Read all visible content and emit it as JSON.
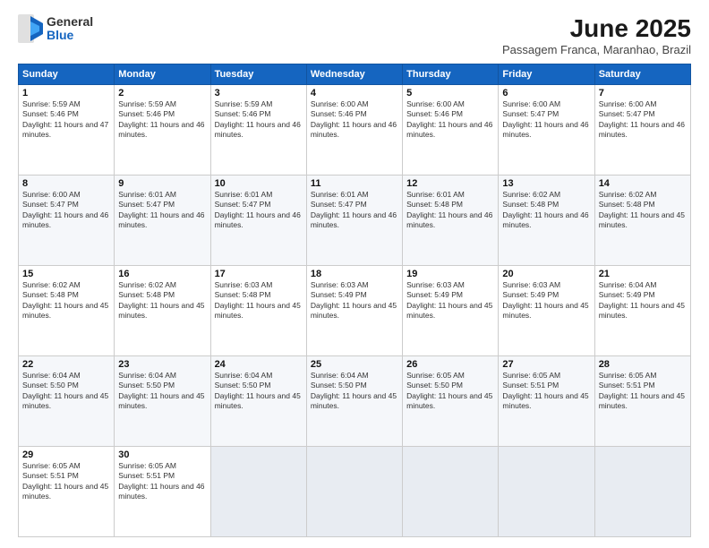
{
  "logo": {
    "general": "General",
    "blue": "Blue"
  },
  "title": "June 2025",
  "subtitle": "Passagem Franca, Maranhao, Brazil",
  "days_of_week": [
    "Sunday",
    "Monday",
    "Tuesday",
    "Wednesday",
    "Thursday",
    "Friday",
    "Saturday"
  ],
  "weeks": [
    [
      {
        "day": 1,
        "sunrise": "5:59 AM",
        "sunset": "5:46 PM",
        "daylight": "11 hours and 47 minutes."
      },
      {
        "day": 2,
        "sunrise": "5:59 AM",
        "sunset": "5:46 PM",
        "daylight": "11 hours and 46 minutes."
      },
      {
        "day": 3,
        "sunrise": "5:59 AM",
        "sunset": "5:46 PM",
        "daylight": "11 hours and 46 minutes."
      },
      {
        "day": 4,
        "sunrise": "6:00 AM",
        "sunset": "5:46 PM",
        "daylight": "11 hours and 46 minutes."
      },
      {
        "day": 5,
        "sunrise": "6:00 AM",
        "sunset": "5:46 PM",
        "daylight": "11 hours and 46 minutes."
      },
      {
        "day": 6,
        "sunrise": "6:00 AM",
        "sunset": "5:47 PM",
        "daylight": "11 hours and 46 minutes."
      },
      {
        "day": 7,
        "sunrise": "6:00 AM",
        "sunset": "5:47 PM",
        "daylight": "11 hours and 46 minutes."
      }
    ],
    [
      {
        "day": 8,
        "sunrise": "6:00 AM",
        "sunset": "5:47 PM",
        "daylight": "11 hours and 46 minutes."
      },
      {
        "day": 9,
        "sunrise": "6:01 AM",
        "sunset": "5:47 PM",
        "daylight": "11 hours and 46 minutes."
      },
      {
        "day": 10,
        "sunrise": "6:01 AM",
        "sunset": "5:47 PM",
        "daylight": "11 hours and 46 minutes."
      },
      {
        "day": 11,
        "sunrise": "6:01 AM",
        "sunset": "5:47 PM",
        "daylight": "11 hours and 46 minutes."
      },
      {
        "day": 12,
        "sunrise": "6:01 AM",
        "sunset": "5:48 PM",
        "daylight": "11 hours and 46 minutes."
      },
      {
        "day": 13,
        "sunrise": "6:02 AM",
        "sunset": "5:48 PM",
        "daylight": "11 hours and 46 minutes."
      },
      {
        "day": 14,
        "sunrise": "6:02 AM",
        "sunset": "5:48 PM",
        "daylight": "11 hours and 45 minutes."
      }
    ],
    [
      {
        "day": 15,
        "sunrise": "6:02 AM",
        "sunset": "5:48 PM",
        "daylight": "11 hours and 45 minutes."
      },
      {
        "day": 16,
        "sunrise": "6:02 AM",
        "sunset": "5:48 PM",
        "daylight": "11 hours and 45 minutes."
      },
      {
        "day": 17,
        "sunrise": "6:03 AM",
        "sunset": "5:48 PM",
        "daylight": "11 hours and 45 minutes."
      },
      {
        "day": 18,
        "sunrise": "6:03 AM",
        "sunset": "5:49 PM",
        "daylight": "11 hours and 45 minutes."
      },
      {
        "day": 19,
        "sunrise": "6:03 AM",
        "sunset": "5:49 PM",
        "daylight": "11 hours and 45 minutes."
      },
      {
        "day": 20,
        "sunrise": "6:03 AM",
        "sunset": "5:49 PM",
        "daylight": "11 hours and 45 minutes."
      },
      {
        "day": 21,
        "sunrise": "6:04 AM",
        "sunset": "5:49 PM",
        "daylight": "11 hours and 45 minutes."
      }
    ],
    [
      {
        "day": 22,
        "sunrise": "6:04 AM",
        "sunset": "5:50 PM",
        "daylight": "11 hours and 45 minutes."
      },
      {
        "day": 23,
        "sunrise": "6:04 AM",
        "sunset": "5:50 PM",
        "daylight": "11 hours and 45 minutes."
      },
      {
        "day": 24,
        "sunrise": "6:04 AM",
        "sunset": "5:50 PM",
        "daylight": "11 hours and 45 minutes."
      },
      {
        "day": 25,
        "sunrise": "6:04 AM",
        "sunset": "5:50 PM",
        "daylight": "11 hours and 45 minutes."
      },
      {
        "day": 26,
        "sunrise": "6:05 AM",
        "sunset": "5:50 PM",
        "daylight": "11 hours and 45 minutes."
      },
      {
        "day": 27,
        "sunrise": "6:05 AM",
        "sunset": "5:51 PM",
        "daylight": "11 hours and 45 minutes."
      },
      {
        "day": 28,
        "sunrise": "6:05 AM",
        "sunset": "5:51 PM",
        "daylight": "11 hours and 45 minutes."
      }
    ],
    [
      {
        "day": 29,
        "sunrise": "6:05 AM",
        "sunset": "5:51 PM",
        "daylight": "11 hours and 45 minutes."
      },
      {
        "day": 30,
        "sunrise": "6:05 AM",
        "sunset": "5:51 PM",
        "daylight": "11 hours and 46 minutes."
      },
      null,
      null,
      null,
      null,
      null
    ]
  ]
}
